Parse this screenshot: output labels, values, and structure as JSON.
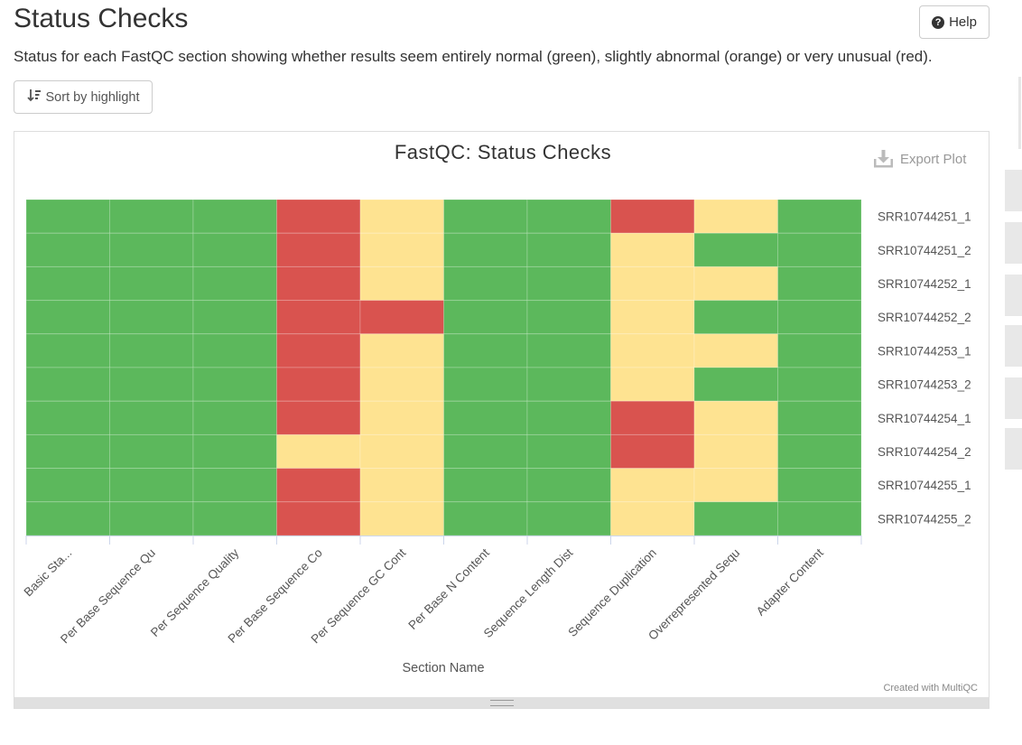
{
  "page": {
    "title": "Status Checks",
    "help_label": "Help",
    "description": "Status for each FastQC section showing whether results seem entirely normal (green), slightly abnormal (orange) or very unusual (red).",
    "sort_label": "Sort by highlight"
  },
  "plot": {
    "export_label": "Export Plot",
    "credit": "Created with MultiQC"
  },
  "colors": {
    "pass": "#5cb85c",
    "warn": "#fee391",
    "fail": "#d9534f"
  },
  "icons": [
    "question-circle-icon",
    "sort-icon",
    "download-icon",
    "resize-grip-icon"
  ],
  "chart_data": {
    "type": "heatmap",
    "title": "FastQC: Status Checks",
    "xlabel": "Section Name",
    "ylabel": "",
    "x_categories": [
      "Basic Sta...",
      "Per Base Sequence Qu",
      "Per Sequence Quality",
      "Per Base Sequence Co",
      "Per Sequence GC Cont",
      "Per Base N Content",
      "Sequence Length Dist",
      "Sequence Duplication",
      "Overrepresented Sequ",
      "Adapter Content"
    ],
    "y_categories": [
      "SRR10744251_1",
      "SRR10744251_2",
      "SRR10744252_1",
      "SRR10744252_2",
      "SRR10744253_1",
      "SRR10744253_2",
      "SRR10744254_1",
      "SRR10744254_2",
      "SRR10744255_1",
      "SRR10744255_2"
    ],
    "value_scale": {
      "pass": 1,
      "warn": 0.5,
      "fail": 0.25
    },
    "values": [
      [
        1,
        1,
        1,
        0.25,
        0.5,
        1,
        1,
        0.25,
        0.5,
        1
      ],
      [
        1,
        1,
        1,
        0.25,
        0.5,
        1,
        1,
        0.5,
        1,
        1
      ],
      [
        1,
        1,
        1,
        0.25,
        0.5,
        1,
        1,
        0.5,
        0.5,
        1
      ],
      [
        1,
        1,
        1,
        0.25,
        0.25,
        1,
        1,
        0.5,
        1,
        1
      ],
      [
        1,
        1,
        1,
        0.25,
        0.5,
        1,
        1,
        0.5,
        0.5,
        1
      ],
      [
        1,
        1,
        1,
        0.25,
        0.5,
        1,
        1,
        0.5,
        1,
        1
      ],
      [
        1,
        1,
        1,
        0.25,
        0.5,
        1,
        1,
        0.25,
        0.5,
        1
      ],
      [
        1,
        1,
        1,
        0.5,
        0.5,
        1,
        1,
        0.25,
        0.5,
        1
      ],
      [
        1,
        1,
        1,
        0.25,
        0.5,
        1,
        1,
        0.5,
        0.5,
        1
      ],
      [
        1,
        1,
        1,
        0.25,
        0.5,
        1,
        1,
        0.5,
        1,
        1
      ]
    ],
    "legend": "none",
    "grid": true
  }
}
